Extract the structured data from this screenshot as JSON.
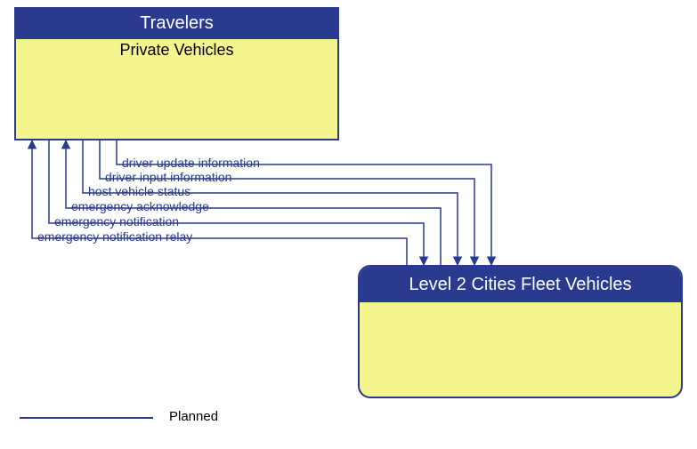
{
  "boxes": {
    "top": {
      "header": "Travelers",
      "sub": "Private Vehicles"
    },
    "bottom": {
      "header": "Level 2 Cities Fleet Vehicles"
    }
  },
  "flows": [
    {
      "label": "driver update information"
    },
    {
      "label": "driver input information"
    },
    {
      "label": "host vehicle status"
    },
    {
      "label": "emergency acknowledge"
    },
    {
      "label": "emergency notification"
    },
    {
      "label": "emergency notification relay"
    }
  ],
  "legend": {
    "planned": "Planned"
  },
  "colors": {
    "line": "#2a3b8f",
    "fill": "#f5f58f"
  }
}
